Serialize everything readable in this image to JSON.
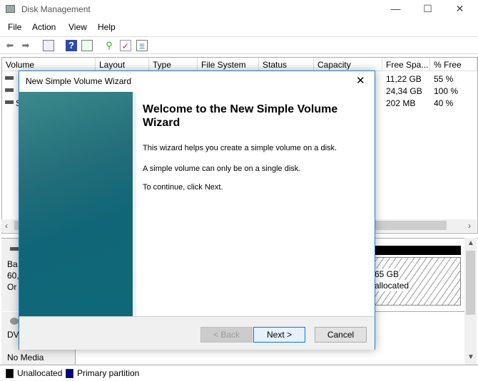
{
  "window": {
    "title": "Disk Management",
    "minimize": "—",
    "maximize": "☐",
    "close": "✕"
  },
  "menu": [
    "File",
    "Action",
    "View",
    "Help"
  ],
  "toolbar": [
    "back-icon",
    "forward-icon",
    "console-tree-icon",
    "help-icon",
    "action-pane-icon",
    "connect-icon",
    "check-icon",
    "properties-icon"
  ],
  "list": {
    "columns": [
      "Volume",
      "Layout",
      "Type",
      "File System",
      "Status",
      "Capacity",
      "Free Spa...",
      "% Free"
    ],
    "rows": [
      {
        "volume": "",
        "free": "11,22 GB",
        "pct": "55 %"
      },
      {
        "volume": "",
        "free": "24,34 GB",
        "pct": "100 %"
      },
      {
        "volume": "S",
        "free": "202 MB",
        "pct": "40 %"
      }
    ]
  },
  "disks": [
    {
      "lines": [
        "Ba",
        "60,",
        "Or"
      ],
      "partition_size": "65 GB",
      "partition_status": "allocated"
    },
    {
      "lines": [
        "DV",
        "",
        "No Media"
      ]
    }
  ],
  "legend": [
    {
      "label": "Unallocated",
      "color": "#000000"
    },
    {
      "label": "Primary partition",
      "color": "#000080"
    }
  ],
  "dialog": {
    "title": "New Simple Volume Wizard",
    "heading": "Welcome to the New Simple Volume Wizard",
    "paragraphs": [
      "This wizard helps you create a simple volume on a disk.",
      "A simple volume can only be on a single disk.",
      "To continue, click Next."
    ],
    "back": "< Back",
    "next": "Next >",
    "cancel": "Cancel",
    "close": "✕"
  }
}
